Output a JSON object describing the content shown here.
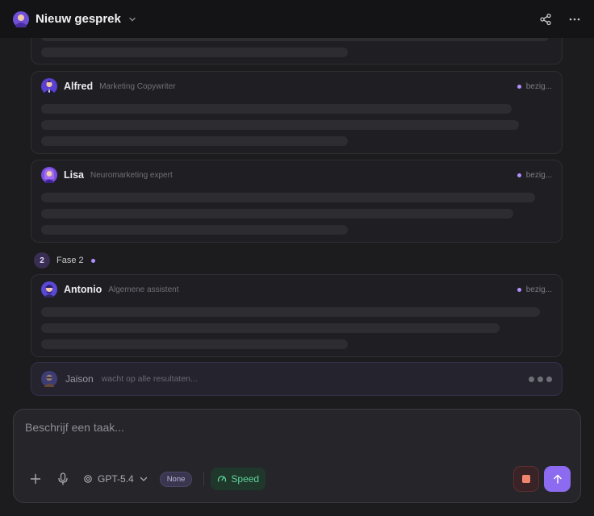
{
  "header": {
    "title": "Nieuw gesprek"
  },
  "agents": [
    {
      "name": "Alfred",
      "role": "Marketing Copywriter",
      "status": "bezig..."
    },
    {
      "name": "Lisa",
      "role": "Neuromarketing expert",
      "status": "bezig..."
    },
    {
      "name": "Antonio",
      "role": "Algemene assistent",
      "status": "bezig..."
    }
  ],
  "phase": {
    "number": "2",
    "label": "Fase 2"
  },
  "waiting": {
    "name": "Jaison",
    "text": "wacht op alle resultaten..."
  },
  "composer": {
    "placeholder": "Beschrijf een taak...",
    "model": "GPT-5.4",
    "reasoning": "None",
    "speed": "Speed"
  },
  "colors": {
    "accent": "#8c6bf0",
    "status_dot": "#b390ff",
    "speed_green": "#5fd39a",
    "stop_red": "#f0856e"
  }
}
